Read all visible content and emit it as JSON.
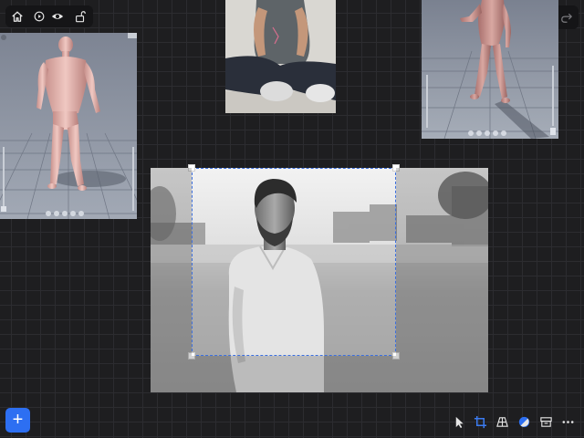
{
  "canvas": {
    "background": "#1e1e20",
    "grid_color": "#2c2c30"
  },
  "topbar": {
    "icons": [
      "home-icon",
      "play-circle-icon",
      "eye-icon",
      "unlock-icon"
    ],
    "undo_icon": "undo-icon",
    "redo_icon": "redo-icon"
  },
  "images": [
    {
      "id": "model-back-view",
      "kind": "3d-viewport"
    },
    {
      "id": "sitting-man-photo",
      "kind": "photo"
    },
    {
      "id": "model-front-view",
      "kind": "3d-viewport"
    },
    {
      "id": "beach-portrait-photo",
      "kind": "photo",
      "state": "selected-cropping"
    }
  ],
  "selection": {
    "border_color": "#3b6fe0",
    "style": "dashed"
  },
  "add_button": {
    "label": "+",
    "color": "#2d6ff2"
  },
  "toolbar": {
    "tools": [
      "select-icon",
      "crop-icon",
      "perspective-icon",
      "color-adjust-icon",
      "archive-icon",
      "more-icon"
    ],
    "active_tool": "crop-icon",
    "accent": "#3b7bf0"
  }
}
